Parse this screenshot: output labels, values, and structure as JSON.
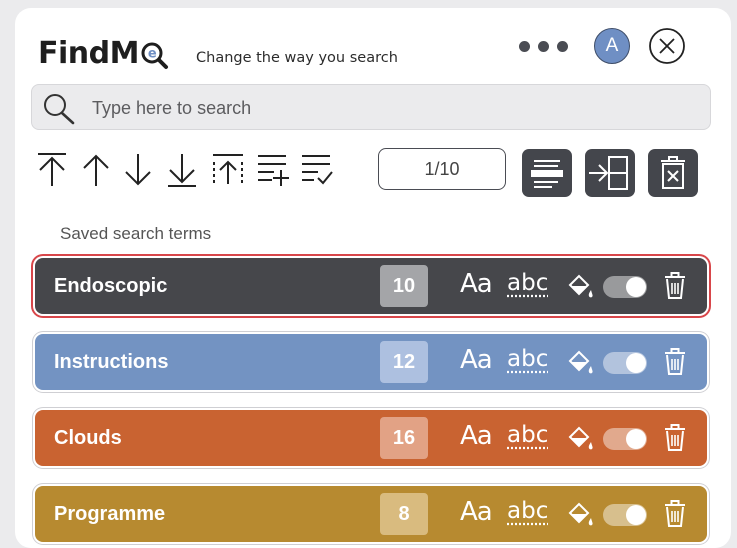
{
  "header": {
    "brand": "FindM",
    "tagline": "Change the way you search",
    "avatar_letter": "A",
    "icons": [
      "magnifier-logo-icon",
      "more-dots-icon",
      "close-icon"
    ]
  },
  "search": {
    "placeholder": "Type here to search",
    "value": ""
  },
  "toolbar": {
    "tools": [
      "jump-to-first-icon",
      "previous-match-icon",
      "next-match-icon",
      "jump-to-last-icon",
      "scroll-to-top-icon",
      "add-term-icon",
      "checklist-icon"
    ],
    "counter": "1/10",
    "actions": [
      "highlight-mode-icon",
      "side-panel-icon",
      "clear-all-icon"
    ]
  },
  "saved": {
    "label": "Saved search terms",
    "terms": [
      {
        "text": "Endoscopic",
        "count": "10",
        "color": "#46474b",
        "badge": "#a4a5a8",
        "selected": true
      },
      {
        "text": "Instructions",
        "count": "12",
        "color": "#7393c2",
        "badge": "#adc0e0",
        "selected": false
      },
      {
        "text": "Clouds",
        "count": "16",
        "color": "#c96331",
        "badge": "#e2a285",
        "selected": false
      },
      {
        "text": "Programme",
        "count": "8",
        "color": "#b78a30",
        "badge": "#d9bb7f",
        "selected": false
      }
    ],
    "match_case_label": "Aa",
    "whole_word_label": "abc"
  },
  "colors": {
    "accent": "#6f8fc4",
    "dark": "#44464c",
    "selected_outline": "#d8464a"
  }
}
